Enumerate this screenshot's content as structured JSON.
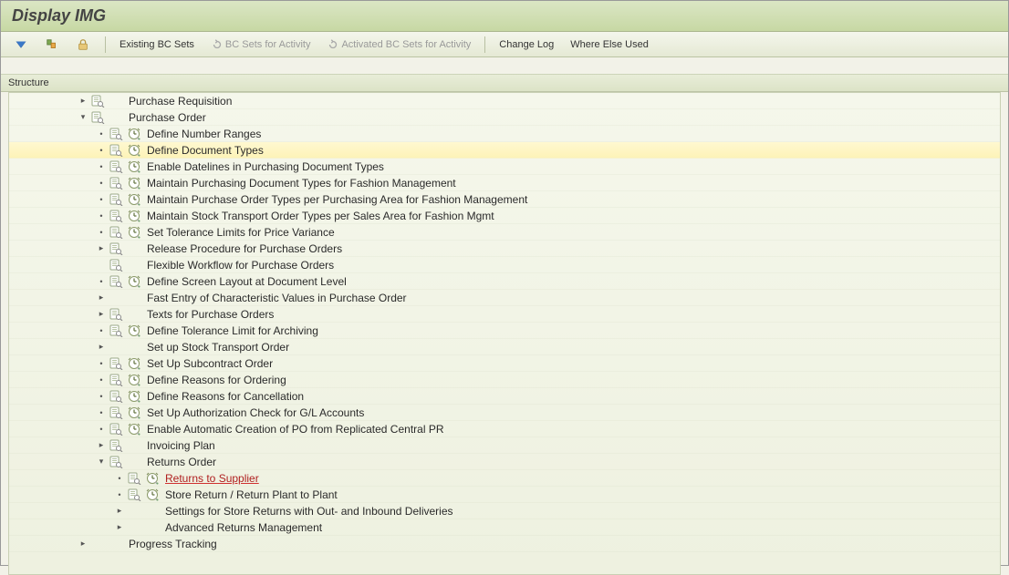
{
  "title": "Display IMG",
  "toolbar": {
    "existing_bc": "Existing BC Sets",
    "bc_for_activity": "BC Sets for Activity",
    "activated_bc": "Activated BC Sets for Activity",
    "change_log": "Change Log",
    "where_else": "Where Else Used"
  },
  "section": "Structure",
  "tree": [
    {
      "indent": 75,
      "toggle": "▸",
      "doc": true,
      "clock": false,
      "label": "Purchase Requisition"
    },
    {
      "indent": 75,
      "toggle": "▾",
      "doc": true,
      "clock": false,
      "label": "Purchase Order"
    },
    {
      "indent": 95,
      "toggle": "•",
      "doc": true,
      "clock": true,
      "label": "Define Number Ranges"
    },
    {
      "indent": 95,
      "toggle": "•",
      "doc": true,
      "clock": true,
      "label": "Define Document Types",
      "selected": true
    },
    {
      "indent": 95,
      "toggle": "•",
      "doc": true,
      "clock": true,
      "label": "Enable Datelines in Purchasing Document Types"
    },
    {
      "indent": 95,
      "toggle": "•",
      "doc": true,
      "clock": true,
      "label": "Maintain Purchasing Document Types for Fashion Management"
    },
    {
      "indent": 95,
      "toggle": "•",
      "doc": true,
      "clock": true,
      "label": "Maintain Purchase Order Types per Purchasing Area for Fashion Management"
    },
    {
      "indent": 95,
      "toggle": "•",
      "doc": true,
      "clock": true,
      "label": "Maintain Stock Transport Order Types per Sales Area for Fashion Mgmt"
    },
    {
      "indent": 95,
      "toggle": "•",
      "doc": true,
      "clock": true,
      "label": "Set Tolerance Limits for Price Variance"
    },
    {
      "indent": 95,
      "toggle": "▸",
      "doc": true,
      "clock": false,
      "label": "Release Procedure for Purchase Orders"
    },
    {
      "indent": 95,
      "toggle": "",
      "doc": true,
      "clock": false,
      "label": "Flexible Workflow for Purchase Orders"
    },
    {
      "indent": 95,
      "toggle": "•",
      "doc": true,
      "clock": true,
      "label": "Define Screen Layout at Document Level"
    },
    {
      "indent": 95,
      "toggle": "▸",
      "doc": false,
      "clock": false,
      "label": "Fast Entry of Characteristic Values in Purchase Order"
    },
    {
      "indent": 95,
      "toggle": "▸",
      "doc": true,
      "clock": false,
      "label": "Texts for Purchase Orders"
    },
    {
      "indent": 95,
      "toggle": "•",
      "doc": true,
      "clock": true,
      "label": "Define Tolerance Limit for Archiving"
    },
    {
      "indent": 95,
      "toggle": "▸",
      "doc": false,
      "clock": false,
      "label": "Set up Stock Transport Order"
    },
    {
      "indent": 95,
      "toggle": "•",
      "doc": true,
      "clock": true,
      "label": "Set Up Subcontract Order"
    },
    {
      "indent": 95,
      "toggle": "•",
      "doc": true,
      "clock": true,
      "label": "Define Reasons for Ordering"
    },
    {
      "indent": 95,
      "toggle": "•",
      "doc": true,
      "clock": true,
      "label": "Define Reasons for Cancellation"
    },
    {
      "indent": 95,
      "toggle": "•",
      "doc": true,
      "clock": true,
      "label": "Set Up Authorization Check for G/L Accounts"
    },
    {
      "indent": 95,
      "toggle": "•",
      "doc": true,
      "clock": true,
      "label": "Enable Automatic Creation of PO from Replicated Central PR"
    },
    {
      "indent": 95,
      "toggle": "▸",
      "doc": true,
      "clock": false,
      "label": "Invoicing Plan"
    },
    {
      "indent": 95,
      "toggle": "▾",
      "doc": true,
      "clock": false,
      "label": "Returns Order"
    },
    {
      "indent": 115,
      "toggle": "•",
      "doc": true,
      "clock": true,
      "label": "Returns to Supplier",
      "redline": true
    },
    {
      "indent": 115,
      "toggle": "•",
      "doc": true,
      "clock": true,
      "label": "Store Return / Return Plant to Plant"
    },
    {
      "indent": 115,
      "toggle": "▸",
      "doc": false,
      "clock": false,
      "label": "Settings for Store Returns with Out- and Inbound Deliveries"
    },
    {
      "indent": 115,
      "toggle": "▸",
      "doc": false,
      "clock": false,
      "label": "Advanced Returns Management"
    },
    {
      "indent": 75,
      "toggle": "▸",
      "doc": false,
      "clock": false,
      "label": "Progress Tracking"
    }
  ]
}
